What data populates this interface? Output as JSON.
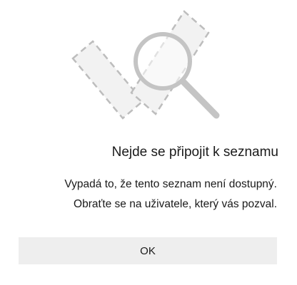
{
  "dialog": {
    "illustration_icon": "search-magnifier-dashed-list-icon",
    "title": "Nejde se připojit k seznamu",
    "message_line1": "Vypadá to, že tento seznam není dostupný.",
    "message_line2": "Obraťte se na uživatele, který vás pozval.",
    "ok_label": "OK"
  },
  "colors": {
    "background": "#ffffff",
    "illustration_fill": "#f2f2f2",
    "illustration_stroke": "#c4c4c4",
    "button_bg": "#eeeeee",
    "text": "#1a1a1a"
  }
}
